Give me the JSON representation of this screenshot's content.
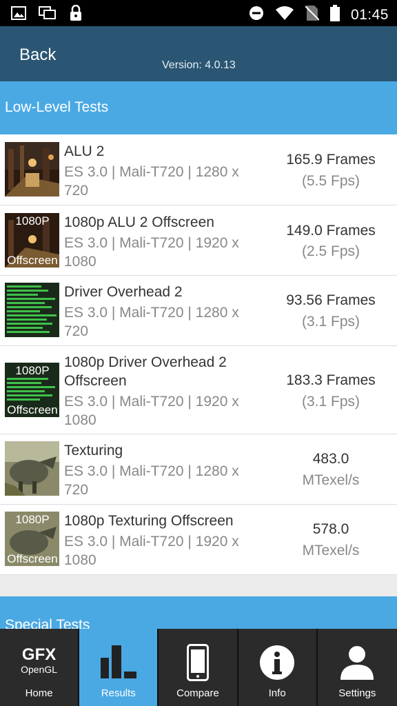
{
  "status_bar": {
    "time": "01:45",
    "icons": [
      "image-icon",
      "overlay-icon",
      "lock-icon",
      "do-not-disturb-icon",
      "wifi-icon",
      "no-sim-icon",
      "battery-icon"
    ]
  },
  "header": {
    "back_label": "Back",
    "version": "Version: 4.0.13"
  },
  "sections": {
    "low_level": "Low-Level Tests",
    "special": "Special Tests"
  },
  "results": [
    {
      "title": "ALU 2",
      "subtitle": "ES 3.0 | Mali-T720 | 1280 x 720",
      "value": "165.9 Frames",
      "secondary": "(5.5 Fps)",
      "thumb": "alu-thumbnail"
    },
    {
      "title": "1080p ALU 2 Offscreen",
      "subtitle": "ES 3.0 | Mali-T720 | 1920 x 1080",
      "value": "149.0 Frames",
      "secondary": "(2.5 Fps)",
      "thumb": "alu-offscreen-thumbnail",
      "badge_top": "1080P",
      "badge_bottom": "Offscreen"
    },
    {
      "title": "Driver Overhead 2",
      "subtitle": "ES 3.0 | Mali-T720 | 1280 x 720",
      "value": "93.56 Frames",
      "secondary": "(3.1 Fps)",
      "thumb": "driver-overhead-thumbnail"
    },
    {
      "title": "1080p Driver Overhead 2 Offscreen",
      "subtitle": "ES 3.0 | Mali-T720 | 1920 x 1080",
      "value": "183.3 Frames",
      "secondary": "(3.1 Fps)",
      "thumb": "driver-overhead-offscreen-thumbnail",
      "badge_top": "1080P",
      "badge_bottom": "Offscreen"
    },
    {
      "title": "Texturing",
      "subtitle": "ES 3.0 | Mali-T720 | 1280 x 720",
      "value": "483.0",
      "secondary": "MTexel/s",
      "thumb": "texturing-thumbnail"
    },
    {
      "title": "1080p Texturing Offscreen",
      "subtitle": "ES 3.0 | Mali-T720 | 1920 x 1080",
      "value": "578.0",
      "secondary": "MTexel/s",
      "thumb": "texturing-offscreen-thumbnail",
      "badge_top": "1080P",
      "badge_bottom": "Offscreen"
    }
  ],
  "nav": {
    "logo_top": "GFX",
    "logo_bottom": "OpenGL",
    "tabs": [
      {
        "label": "Home",
        "icon": "gfx-logo-icon"
      },
      {
        "label": "Results",
        "icon": "bar-chart-icon",
        "active": true
      },
      {
        "label": "Compare",
        "icon": "phone-icon"
      },
      {
        "label": "Info",
        "icon": "info-icon"
      },
      {
        "label": "Settings",
        "icon": "user-icon"
      }
    ]
  },
  "colors": {
    "status_bar": "#000000",
    "app_bar": "#2a5673",
    "section_header": "#4aa9e3",
    "active_tab": "#4aa9e3",
    "nav_background": "#2b2b2b",
    "page_background": "#ececec"
  }
}
